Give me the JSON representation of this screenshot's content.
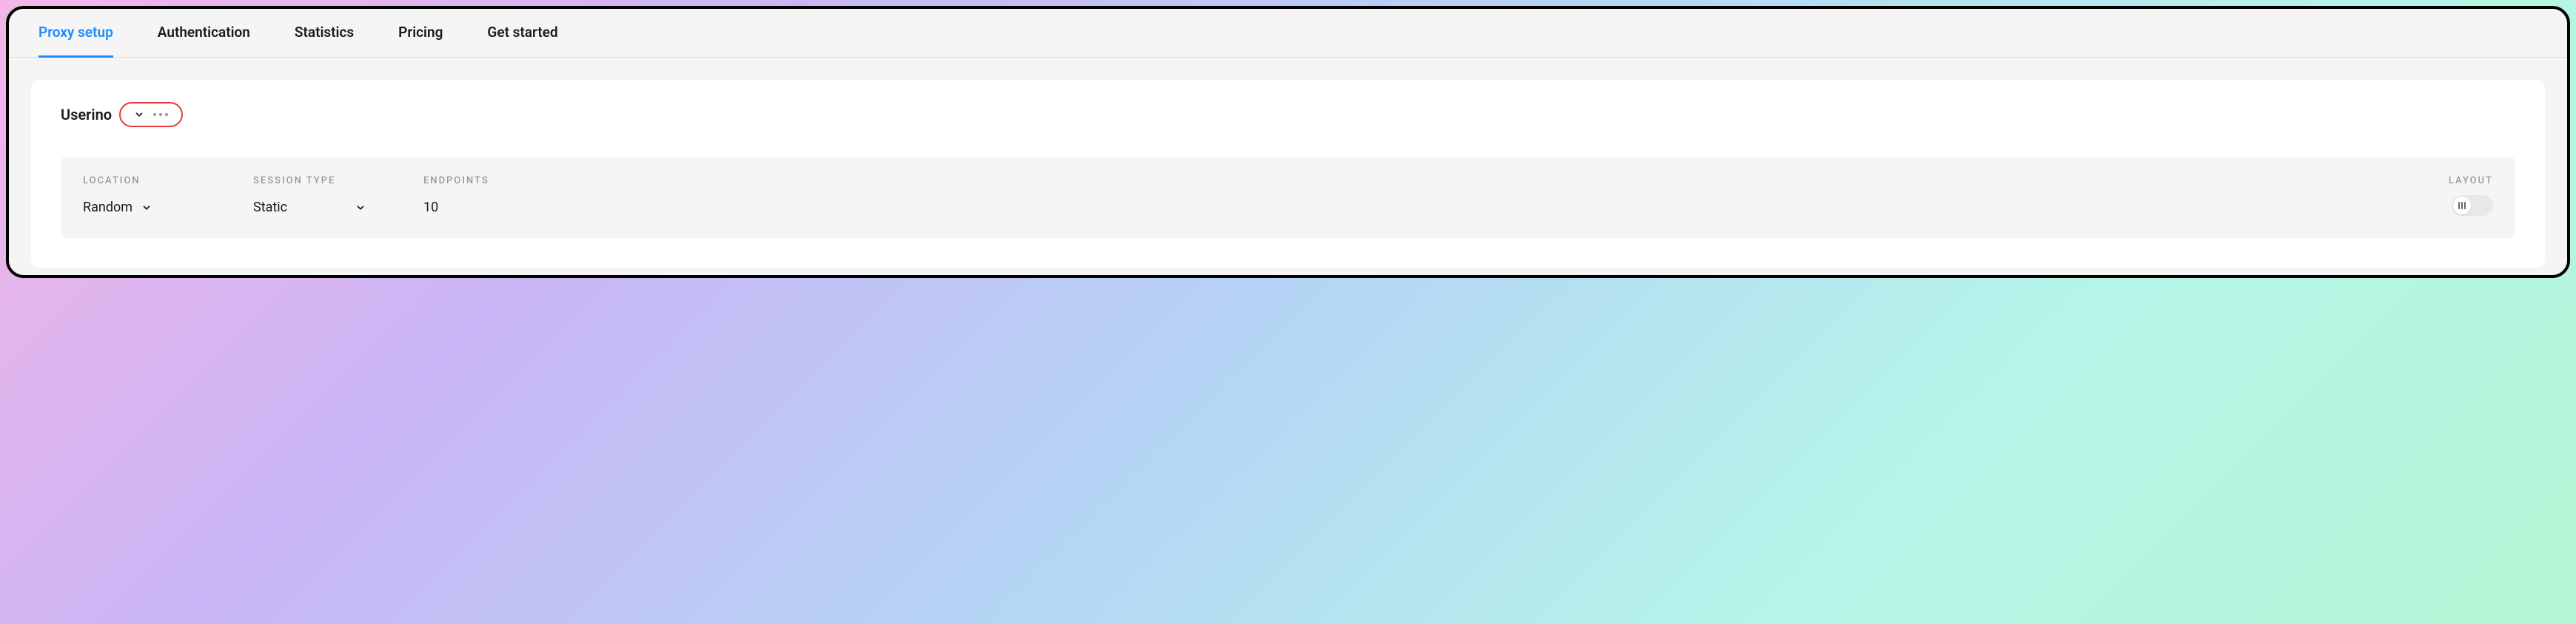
{
  "tabs": [
    {
      "label": "Proxy setup",
      "active": true
    },
    {
      "label": "Authentication",
      "active": false
    },
    {
      "label": "Statistics",
      "active": false
    },
    {
      "label": "Pricing",
      "active": false
    },
    {
      "label": "Get started",
      "active": false
    }
  ],
  "user": {
    "name": "Userino"
  },
  "config": {
    "location": {
      "label": "LOCATION",
      "value": "Random"
    },
    "session_type": {
      "label": "SESSION TYPE",
      "value": "Static"
    },
    "endpoints": {
      "label": "ENDPOINTS",
      "value": "10"
    },
    "layout": {
      "label": "LAYOUT"
    }
  },
  "highlight_color": "#e53935"
}
